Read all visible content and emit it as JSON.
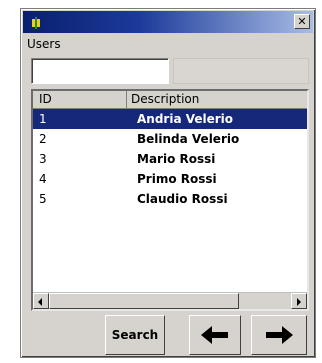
{
  "window": {
    "title": "",
    "close_glyph": "✕"
  },
  "form": {
    "users_label": "Users",
    "search_value": "",
    "search_placeholder": ""
  },
  "grid": {
    "columns": [
      "ID",
      "Description"
    ],
    "rows": [
      {
        "id": "1",
        "description": "Andria Velerio",
        "selected": true
      },
      {
        "id": "2",
        "description": "Belinda Velerio",
        "selected": false
      },
      {
        "id": "3",
        "description": "Mario Rossi",
        "selected": false
      },
      {
        "id": "4",
        "description": "Primo Rossi",
        "selected": false
      },
      {
        "id": "5",
        "description": "Claudio Rossi",
        "selected": false
      }
    ]
  },
  "toolbar": {
    "search_label": "Search",
    "prev_icon": "arrow-left-icon",
    "next_icon": "arrow-right-icon"
  },
  "colors": {
    "selection": "#15287a",
    "titlebar_start": "#0a1f6e",
    "titlebar_end": "#a9bde6",
    "face": "#d6d3ce"
  }
}
